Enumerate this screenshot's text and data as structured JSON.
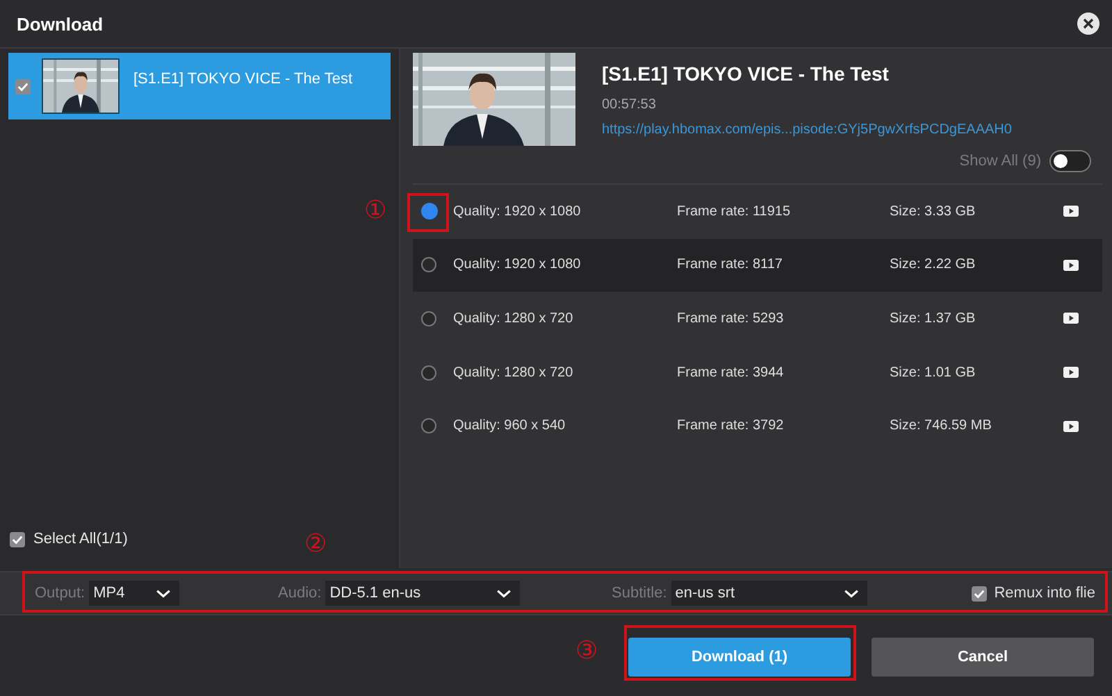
{
  "window": {
    "title": "Download"
  },
  "episodes": [
    {
      "title": "[S1.E1] TOKYO VICE - The Test",
      "checked": true,
      "selected": true
    }
  ],
  "select_all": {
    "label": "Select All(1/1)",
    "checked": true
  },
  "detail": {
    "title": "[S1.E1] TOKYO VICE - The Test",
    "duration": "00:57:53",
    "url": "https://play.hbomax.com/epis...pisode:GYj5PgwXrfsPCDgEAAAH0"
  },
  "show_all": {
    "label": "Show All",
    "count": "(9)",
    "on": false
  },
  "streams": [
    {
      "quality": "Quality: 1920 x 1080",
      "frame_rate": "Frame rate: 11915",
      "size": "Size: 3.33 GB",
      "selected": true,
      "highlighted": false
    },
    {
      "quality": "Quality: 1920 x 1080",
      "frame_rate": "Frame rate: 8117",
      "size": "Size: 2.22 GB",
      "selected": false,
      "highlighted": true
    },
    {
      "quality": "Quality: 1280 x 720",
      "frame_rate": "Frame rate: 5293",
      "size": "Size: 1.37 GB",
      "selected": false,
      "highlighted": false
    },
    {
      "quality": "Quality: 1280 x 720",
      "frame_rate": "Frame rate: 3944",
      "size": "Size: 1.01 GB",
      "selected": false,
      "highlighted": false
    },
    {
      "quality": "Quality: 960 x 540",
      "frame_rate": "Frame rate: 3792",
      "size": "Size: 746.59 MB",
      "selected": false,
      "highlighted": false
    }
  ],
  "options": [
    {
      "label": "Output:",
      "value": "MP4"
    },
    {
      "label": "Audio:",
      "value": "DD-5.1 en-us"
    },
    {
      "label": "Subtitle:",
      "value": "en-us srt"
    }
  ],
  "remux": {
    "label": "Remux into flie",
    "checked": true
  },
  "buttons": [
    {
      "label": "Download (1)",
      "kind": "primary"
    },
    {
      "label": "Cancel",
      "kind": "secondary"
    }
  ],
  "annotations": [
    "①",
    "②",
    "③"
  ]
}
